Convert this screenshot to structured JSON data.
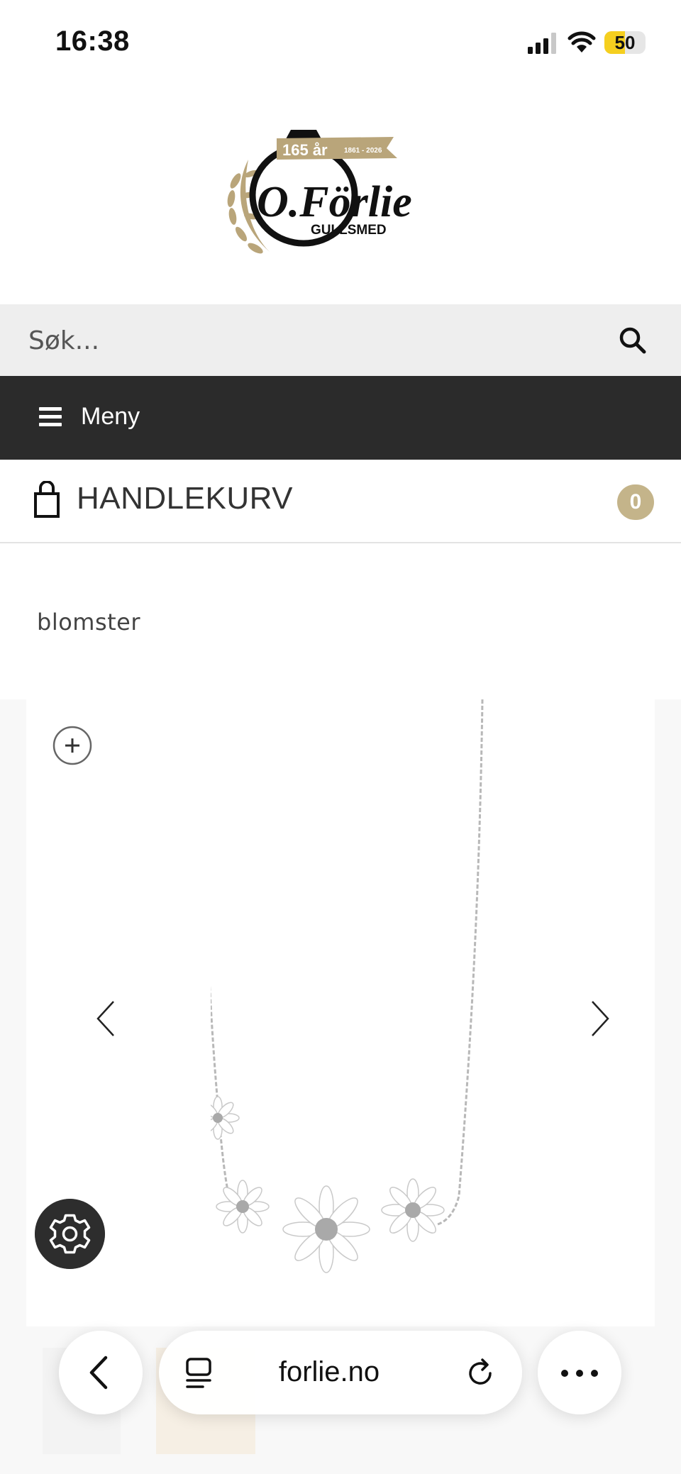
{
  "status_bar": {
    "time": "16:38",
    "battery": "50",
    "battery_level": 0.5
  },
  "brand": {
    "logo_name": "O.Förlie",
    "logo_subtitle": "GULLSMED",
    "anniversary": "165 år",
    "years": "1861 - 2026",
    "colors": {
      "gold": "#b9a57a",
      "dark": "#111111"
    }
  },
  "search": {
    "placeholder": "Søk...",
    "icon": "search-icon"
  },
  "menu": {
    "label": "Meny",
    "icon": "hamburger-icon",
    "background": "#2b2b2b"
  },
  "cart": {
    "label": "HANDLEKURV",
    "count": "0",
    "icon": "shopping-bag-icon",
    "badge_color": "#c4b48a"
  },
  "page": {
    "title": "blomster"
  },
  "gallery": {
    "zoom_icon": "plus-circle-icon",
    "prev_icon": "chevron-left-icon",
    "next_icon": "chevron-right-icon",
    "image": "daisy-necklace"
  },
  "settings": {
    "icon": "gear-icon"
  },
  "browser": {
    "url": "forlie.no",
    "back_icon": "chevron-left-icon",
    "reader_icon": "reader-icon",
    "reload_icon": "reload-icon",
    "more_icon": "ellipsis-icon"
  }
}
